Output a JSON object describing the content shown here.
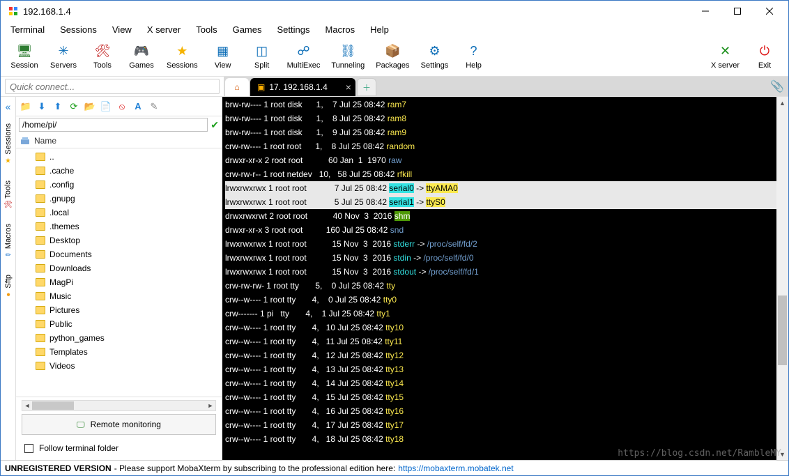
{
  "window": {
    "title": "192.168.1.4"
  },
  "menu": [
    "Terminal",
    "Sessions",
    "View",
    "X server",
    "Tools",
    "Games",
    "Settings",
    "Macros",
    "Help"
  ],
  "toolbar": [
    {
      "name": "session-button",
      "label": "Session",
      "icon": "🖥",
      "color": "#2e7d32"
    },
    {
      "name": "servers-button",
      "label": "Servers",
      "icon": "✳",
      "color": "#0b6db7"
    },
    {
      "name": "tools-button",
      "label": "Tools",
      "icon": "🛠",
      "color": "#c01717"
    },
    {
      "name": "games-button",
      "label": "Games",
      "icon": "🎮",
      "color": "#555"
    },
    {
      "name": "sessions-button",
      "label": "Sessions",
      "icon": "★",
      "color": "#f5b301"
    },
    {
      "name": "view-button",
      "label": "View",
      "icon": "▦",
      "color": "#0b6db7"
    },
    {
      "name": "split-button",
      "label": "Split",
      "icon": "◫",
      "color": "#0b6db7"
    },
    {
      "name": "multiexec-button",
      "label": "MultiExec",
      "icon": "☍",
      "color": "#0b6db7"
    },
    {
      "name": "tunneling-button",
      "label": "Tunneling",
      "icon": "⛓",
      "color": "#0b6db7"
    },
    {
      "name": "packages-button",
      "label": "Packages",
      "icon": "📦",
      "color": "#8a6d3b"
    },
    {
      "name": "settings-button",
      "label": "Settings",
      "icon": "⚙",
      "color": "#0b6db7"
    },
    {
      "name": "help-button",
      "label": "Help",
      "icon": "?",
      "color": "#0b6db7"
    }
  ],
  "toolbar_right": [
    {
      "name": "xserver-button",
      "label": "X server",
      "icon": "✕",
      "color": "#1a8f1a"
    },
    {
      "name": "exit-button",
      "label": "Exit",
      "icon": "⏻",
      "color": "#d11"
    }
  ],
  "quick_placeholder": "Quick connect...",
  "tabs": {
    "active_label": "17. 192.168.1.4"
  },
  "sftp": {
    "path": "/home/pi/",
    "header": "Name",
    "items": [
      "..",
      ".cache",
      ".config",
      ".gnupg",
      ".local",
      ".themes",
      "Desktop",
      "Documents",
      "Downloads",
      "MagPi",
      "Music",
      "Pictures",
      "Public",
      "python_games",
      "Templates",
      "Videos"
    ],
    "remote_btn": "Remote monitoring",
    "follow": "Follow terminal folder"
  },
  "vtabs": [
    {
      "name": "sessions",
      "label": "Sessions",
      "icon": "★",
      "color": "#f5b301"
    },
    {
      "name": "tools",
      "label": "Tools",
      "icon": "🛠",
      "color": "#c01717"
    },
    {
      "name": "macros",
      "label": "Macros",
      "icon": "✏",
      "color": "#2b7dd1"
    },
    {
      "name": "sftp",
      "label": "Sftp",
      "icon": "●",
      "color": "#f39c12"
    }
  ],
  "terminal": [
    {
      "perm": "brw-rw----",
      "n": "1",
      "own": "root",
      "grp": "disk   ",
      "maj": "   1,",
      "sz": "   7",
      "date": "Jul 25 08:42",
      "name": "ram7",
      "ncol": "c-yellow"
    },
    {
      "perm": "brw-rw----",
      "n": "1",
      "own": "root",
      "grp": "disk   ",
      "maj": "   1,",
      "sz": "   8",
      "date": "Jul 25 08:42",
      "name": "ram8",
      "ncol": "c-yellow"
    },
    {
      "perm": "brw-rw----",
      "n": "1",
      "own": "root",
      "grp": "disk   ",
      "maj": "   1,",
      "sz": "   9",
      "date": "Jul 25 08:42",
      "name": "ram9",
      "ncol": "c-yellow"
    },
    {
      "perm": "crw-rw----",
      "n": "1",
      "own": "root",
      "grp": "root   ",
      "maj": "   1,",
      "sz": "   8",
      "date": "Jul 25 08:42",
      "name": "random",
      "ncol": "c-yellow"
    },
    {
      "perm": "drwxr-xr-x",
      "n": "2",
      "own": "root",
      "grp": "root   ",
      "maj": "     ",
      "sz": "  60",
      "date": "Jan  1  1970",
      "name": "raw",
      "ncol": "c-bluefld"
    },
    {
      "perm": "crw-rw-r--",
      "n": "1",
      "own": "root",
      "grp": "netdev ",
      "maj": "  10,",
      "sz": "  58",
      "date": "Jul 25 08:42",
      "name": "rfkill",
      "ncol": "c-yellow"
    },
    {
      "perm": "lrwxrwxrwx",
      "n": "1",
      "own": "root",
      "grp": "root   ",
      "maj": "     ",
      "sz": "   7",
      "date": "Jul 25 08:42",
      "name": "serial0",
      "link": "ttyAMA0",
      "sel": true
    },
    {
      "perm": "lrwxrwxrwx",
      "n": "1",
      "own": "root",
      "grp": "root   ",
      "maj": "     ",
      "sz": "   5",
      "date": "Jul 25 08:42",
      "name": "serial1",
      "link": "ttyS0",
      "sel": true
    },
    {
      "perm": "drwxrwxrwt",
      "n": "2",
      "own": "root",
      "grp": "root   ",
      "maj": "     ",
      "sz": "  40",
      "date": "Nov  3  2016",
      "name": "shm",
      "ncol": "bg-gr"
    },
    {
      "perm": "drwxr-xr-x",
      "n": "3",
      "own": "root",
      "grp": "root   ",
      "maj": "     ",
      "sz": " 160",
      "date": "Jul 25 08:42",
      "name": "snd",
      "ncol": "c-bluefld"
    },
    {
      "perm": "lrwxrwxrwx",
      "n": "1",
      "own": "root",
      "grp": "root   ",
      "maj": "     ",
      "sz": "  15",
      "date": "Nov  3  2016",
      "name": "stderr",
      "link2": "/proc/self/fd/2"
    },
    {
      "perm": "lrwxrwxrwx",
      "n": "1",
      "own": "root",
      "grp": "root   ",
      "maj": "     ",
      "sz": "  15",
      "date": "Nov  3  2016",
      "name": "stdin",
      "link2": "/proc/self/fd/0"
    },
    {
      "perm": "lrwxrwxrwx",
      "n": "1",
      "own": "root",
      "grp": "root   ",
      "maj": "     ",
      "sz": "  15",
      "date": "Nov  3  2016",
      "name": "stdout",
      "link2": "/proc/self/fd/1"
    },
    {
      "perm": "crw-rw-rw-",
      "n": "1",
      "own": "root",
      "grp": "tty    ",
      "maj": "   5,",
      "sz": "   0",
      "date": "Jul 25 08:42",
      "name": "tty",
      "ncol": "c-yellow"
    },
    {
      "perm": "crw--w----",
      "n": "1",
      "own": "root",
      "grp": "tty    ",
      "maj": "   4,",
      "sz": "   0",
      "date": "Jul 25 08:42",
      "name": "tty0",
      "ncol": "c-yellow"
    },
    {
      "perm": "crw-------",
      "n": "1",
      "own": "pi  ",
      "grp": "tty    ",
      "maj": "   4,",
      "sz": "   1",
      "date": "Jul 25 08:42",
      "name": "tty1",
      "ncol": "c-yellow"
    },
    {
      "perm": "crw--w----",
      "n": "1",
      "own": "root",
      "grp": "tty    ",
      "maj": "   4,",
      "sz": "  10",
      "date": "Jul 25 08:42",
      "name": "tty10",
      "ncol": "c-yellow"
    },
    {
      "perm": "crw--w----",
      "n": "1",
      "own": "root",
      "grp": "tty    ",
      "maj": "   4,",
      "sz": "  11",
      "date": "Jul 25 08:42",
      "name": "tty11",
      "ncol": "c-yellow"
    },
    {
      "perm": "crw--w----",
      "n": "1",
      "own": "root",
      "grp": "tty    ",
      "maj": "   4,",
      "sz": "  12",
      "date": "Jul 25 08:42",
      "name": "tty12",
      "ncol": "c-yellow"
    },
    {
      "perm": "crw--w----",
      "n": "1",
      "own": "root",
      "grp": "tty    ",
      "maj": "   4,",
      "sz": "  13",
      "date": "Jul 25 08:42",
      "name": "tty13",
      "ncol": "c-yellow"
    },
    {
      "perm": "crw--w----",
      "n": "1",
      "own": "root",
      "grp": "tty    ",
      "maj": "   4,",
      "sz": "  14",
      "date": "Jul 25 08:42",
      "name": "tty14",
      "ncol": "c-yellow"
    },
    {
      "perm": "crw--w----",
      "n": "1",
      "own": "root",
      "grp": "tty    ",
      "maj": "   4,",
      "sz": "  15",
      "date": "Jul 25 08:42",
      "name": "tty15",
      "ncol": "c-yellow"
    },
    {
      "perm": "crw--w----",
      "n": "1",
      "own": "root",
      "grp": "tty    ",
      "maj": "   4,",
      "sz": "  16",
      "date": "Jul 25 08:42",
      "name": "tty16",
      "ncol": "c-yellow"
    },
    {
      "perm": "crw--w----",
      "n": "1",
      "own": "root",
      "grp": "tty    ",
      "maj": "   4,",
      "sz": "  17",
      "date": "Jul 25 08:42",
      "name": "tty17",
      "ncol": "c-yellow"
    },
    {
      "perm": "crw--w----",
      "n": "1",
      "own": "root",
      "grp": "tty    ",
      "maj": "   4,",
      "sz": "  18",
      "date": "Jul 25 08:42",
      "name": "tty18",
      "ncol": "c-yellow"
    }
  ],
  "status": {
    "unreg": "UNREGISTERED VERSION",
    "msg": "  -  Please support MobaXterm by subscribing to the professional edition here:  ",
    "url": "https://mobaxterm.mobatek.net"
  },
  "watermark": "https://blog.csdn.net/RambleMY"
}
